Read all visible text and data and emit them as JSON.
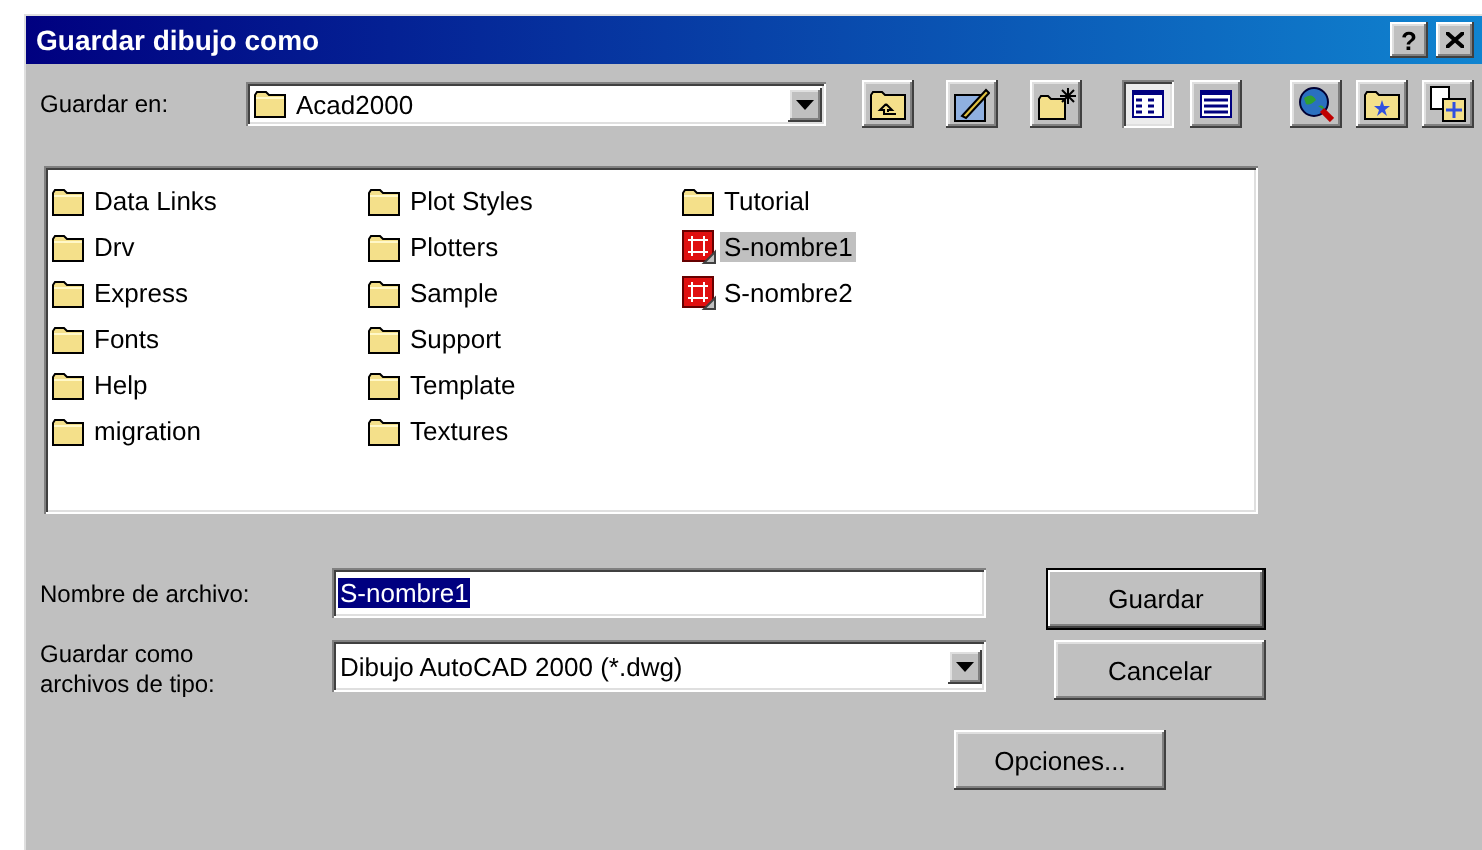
{
  "window": {
    "title": "Guardar dibujo como",
    "help_button": "?"
  },
  "location": {
    "label": "Guardar en:",
    "value": "Acad2000"
  },
  "tools": [
    {
      "kind": "up-folder"
    },
    {
      "kind": "edit"
    },
    {
      "kind": "new-folder"
    },
    {
      "kind": "list-view",
      "selected": true
    },
    {
      "kind": "details-view",
      "selected": false
    },
    {
      "kind": "globe"
    },
    {
      "kind": "favorites"
    },
    {
      "kind": "add-favorite"
    }
  ],
  "files": [
    {
      "name": "Data Links",
      "kind": "folder",
      "selected": false
    },
    {
      "name": "Drv",
      "kind": "folder",
      "selected": false
    },
    {
      "name": "Express",
      "kind": "folder",
      "selected": false
    },
    {
      "name": "Fonts",
      "kind": "folder",
      "selected": false
    },
    {
      "name": "Help",
      "kind": "folder",
      "selected": false
    },
    {
      "name": "migration",
      "kind": "folder",
      "selected": false
    },
    {
      "name": "Plot Styles",
      "kind": "folder",
      "selected": false
    },
    {
      "name": "Plotters",
      "kind": "folder",
      "selected": false
    },
    {
      "name": "Sample",
      "kind": "folder",
      "selected": false
    },
    {
      "name": "Support",
      "kind": "folder",
      "selected": false
    },
    {
      "name": "Template",
      "kind": "folder",
      "selected": false
    },
    {
      "name": "Textures",
      "kind": "folder",
      "selected": false
    },
    {
      "name": "Tutorial",
      "kind": "folder",
      "selected": false
    },
    {
      "name": "S-nombre1",
      "kind": "drawing",
      "selected": true
    },
    {
      "name": "S-nombre2",
      "kind": "drawing",
      "selected": false
    }
  ],
  "filename": {
    "label": "Nombre de archivo:",
    "value": "S-nombre1",
    "highlighted": true
  },
  "filetype": {
    "label_lines": [
      "Guardar como",
      "archivos de tipo:"
    ],
    "value": "Dibujo AutoCAD 2000 (*.dwg)"
  },
  "buttons": [
    {
      "label": "Guardar",
      "default": true
    },
    {
      "label": "Cancelar",
      "default": false
    },
    {
      "label": "Opciones...",
      "default": false
    }
  ]
}
